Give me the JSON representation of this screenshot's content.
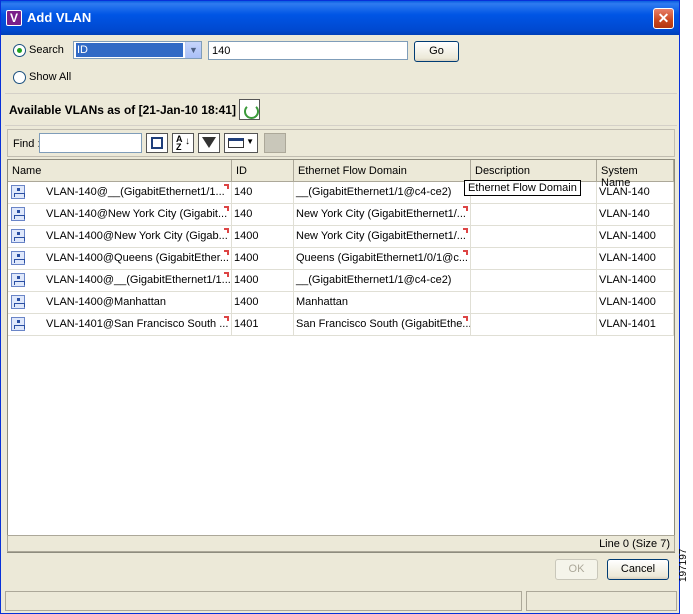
{
  "window": {
    "title": "Add VLAN",
    "app_icon_letter": "V",
    "close_glyph": "✕"
  },
  "search": {
    "search_label": "Search",
    "show_all_label": "Show All",
    "field_selected": "ID",
    "value": "140",
    "go_label": "Go"
  },
  "available": {
    "label": "Available VLANs as of [21-Jan-10 18:41]"
  },
  "toolbar": {
    "find_label": "Find :",
    "find_value": ""
  },
  "table": {
    "columns": [
      "Name",
      "ID",
      "Ethernet Flow Domain",
      "Description",
      "System Name"
    ],
    "rows": [
      {
        "name": "VLAN-140@__(GigabitEthernet1/1...",
        "id": "140",
        "efd": "__(GigabitEthernet1/1@c4-ce2)",
        "description": "",
        "system": "VLAN-140",
        "name_trunc": true,
        "efd_trunc": false
      },
      {
        "name": "VLAN-140@New York City (Gigabit...",
        "id": "140",
        "efd": "New York City (GigabitEthernet1/...",
        "description": "",
        "system": "VLAN-140",
        "name_trunc": true,
        "efd_trunc": true
      },
      {
        "name": "VLAN-1400@New York City (Gigab...",
        "id": "1400",
        "efd": "New York City (GigabitEthernet1/...",
        "description": "",
        "system": "VLAN-1400",
        "name_trunc": true,
        "efd_trunc": true
      },
      {
        "name": "VLAN-1400@Queens (GigabitEther...",
        "id": "1400",
        "efd": "Queens (GigabitEthernet1/0/1@c...",
        "description": "",
        "system": "VLAN-1400",
        "name_trunc": true,
        "efd_trunc": true
      },
      {
        "name": "VLAN-1400@__(GigabitEthernet1/1...",
        "id": "1400",
        "efd": "__(GigabitEthernet1/1@c4-ce2)",
        "description": "",
        "system": "VLAN-1400",
        "name_trunc": true,
        "efd_trunc": false
      },
      {
        "name": "VLAN-1400@Manhattan",
        "id": "1400",
        "efd": "Manhattan",
        "description": "",
        "system": "VLAN-1400",
        "name_trunc": false,
        "efd_trunc": false
      },
      {
        "name": "VLAN-1401@San Francisco South ...",
        "id": "1401",
        "efd": "San Francisco South (GigabitEthe...",
        "description": "",
        "system": "VLAN-1401",
        "name_trunc": true,
        "efd_trunc": true
      }
    ],
    "tooltip": "Ethernet Flow Domain"
  },
  "status": {
    "line_info": "Line 0 (Size 7)"
  },
  "buttons": {
    "ok_label": "OK",
    "cancel_label": "Cancel"
  },
  "side_label": "197197"
}
